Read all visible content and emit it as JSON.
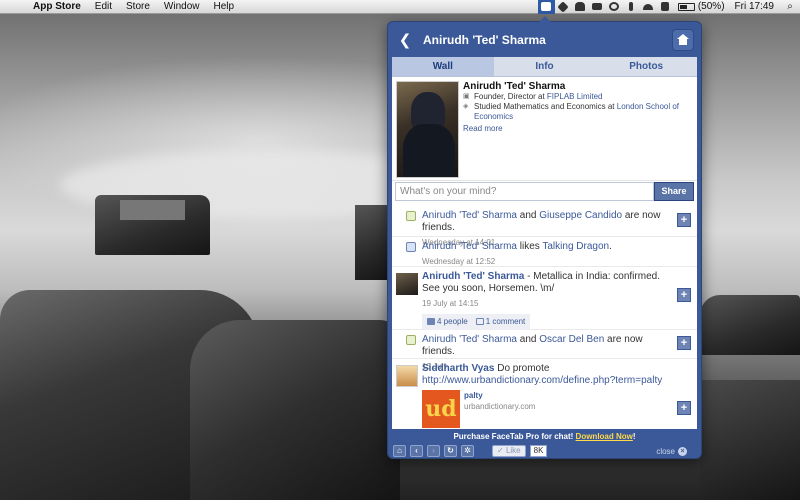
{
  "menubar": {
    "apple": "",
    "app": "App Store",
    "items": [
      "Edit",
      "Store",
      "Window",
      "Help"
    ],
    "battery": "(50%)",
    "clock": "Fri 17:49",
    "spotlight": "⌕"
  },
  "panel": {
    "title": "Anirudh 'Ted' Sharma",
    "back": "❮",
    "tabs": [
      "Wall",
      "Info",
      "Photos"
    ],
    "profile": {
      "name": "Anirudh 'Ted' Sharma",
      "work_prefix": "Founder, Director at ",
      "work_link": "FIPLAB Limited",
      "edu_prefix": "Studied Mathematics and Economics at ",
      "edu_link": "London School of Economics",
      "read_more": "Read more"
    },
    "status": {
      "placeholder": "What's on your mind?",
      "share": "Share"
    },
    "feed": [
      {
        "a": "Anirudh 'Ted' Sharma",
        "mid": " and ",
        "b": "Giuseppe Candido",
        "end": " are now friends.",
        "time": "Wednesday at 14:01"
      },
      {
        "a": "Anirudh 'Ted' Sharma",
        "mid": " likes ",
        "b": "Talking Dragon",
        "end": ".",
        "time": "Wednesday at 12:52"
      },
      {
        "a": "Anirudh 'Ted' Sharma",
        "text": " - Metallica in India: confirmed. See you soon, Horsemen. \\m/",
        "time": "19 July at 14:15",
        "likes": "4 people",
        "comments": "1 comment"
      },
      {
        "a": "Anirudh 'Ted' Sharma",
        "mid": " and ",
        "b": "Oscar Del Ben",
        "end": " are now friends.",
        "time": "13 July"
      },
      {
        "a": "Siddharth Vyas",
        "text": " Do promote",
        "url": "http://www.urbandictionary.com/define.php?term=palty",
        "card_logo": "ud",
        "card_title": "palty",
        "card_domain": "urbandictionary.com"
      }
    ],
    "purchase": {
      "text": "Purchase FaceTab Pro for chat! ",
      "link": "Download Now",
      "end": "!"
    },
    "footer": {
      "like": "Like",
      "count": "8K",
      "close": "close",
      "close_x": "×"
    }
  },
  "colors": {
    "facebook_blue": "#3b5998",
    "header_blue": "#3b5998",
    "tab_bg": "#d8dfea"
  }
}
